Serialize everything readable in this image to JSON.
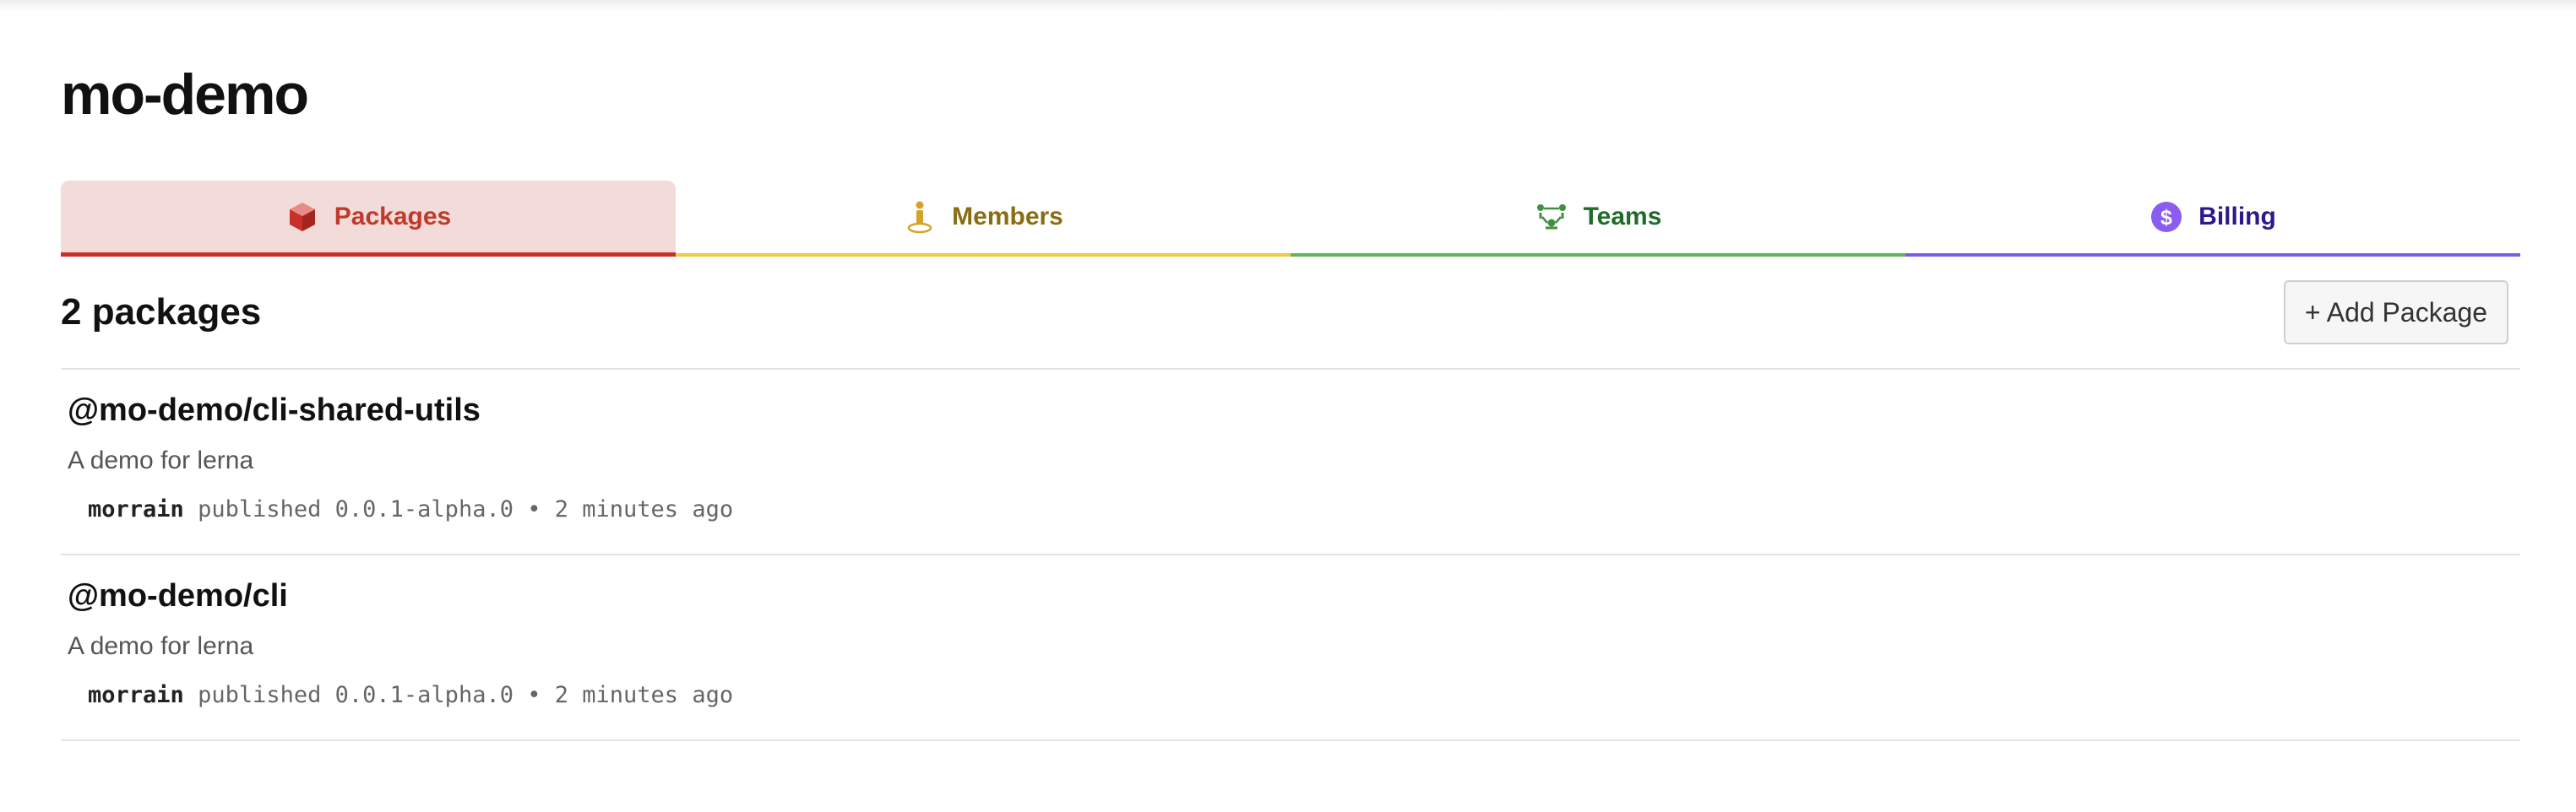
{
  "org": {
    "title": "mo-demo"
  },
  "tabs": [
    {
      "label": "Packages",
      "icon": "package-cube-icon",
      "color": "#c0392b",
      "active": true
    },
    {
      "label": "Members",
      "icon": "member-figure-icon",
      "color": "#8a6d12",
      "active": false
    },
    {
      "label": "Teams",
      "icon": "teams-icon",
      "color": "#1f6b2a",
      "active": false
    },
    {
      "label": "Billing",
      "icon": "dollar-coin-icon",
      "color": "#2a1a8a",
      "active": false
    }
  ],
  "packages_section": {
    "count_label": "2 packages",
    "add_button_label": "+ Add Package"
  },
  "packages": [
    {
      "name": "@mo-demo/cli-shared-utils",
      "description": "A demo for lerna",
      "publisher": "morrain",
      "published_word": "published",
      "version": "0.0.1-alpha.0",
      "separator": "•",
      "time": "2 minutes ago"
    },
    {
      "name": "@mo-demo/cli",
      "description": "A demo for lerna",
      "publisher": "morrain",
      "published_word": "published",
      "version": "0.0.1-alpha.0",
      "separator": "•",
      "time": "2 minutes ago"
    }
  ]
}
